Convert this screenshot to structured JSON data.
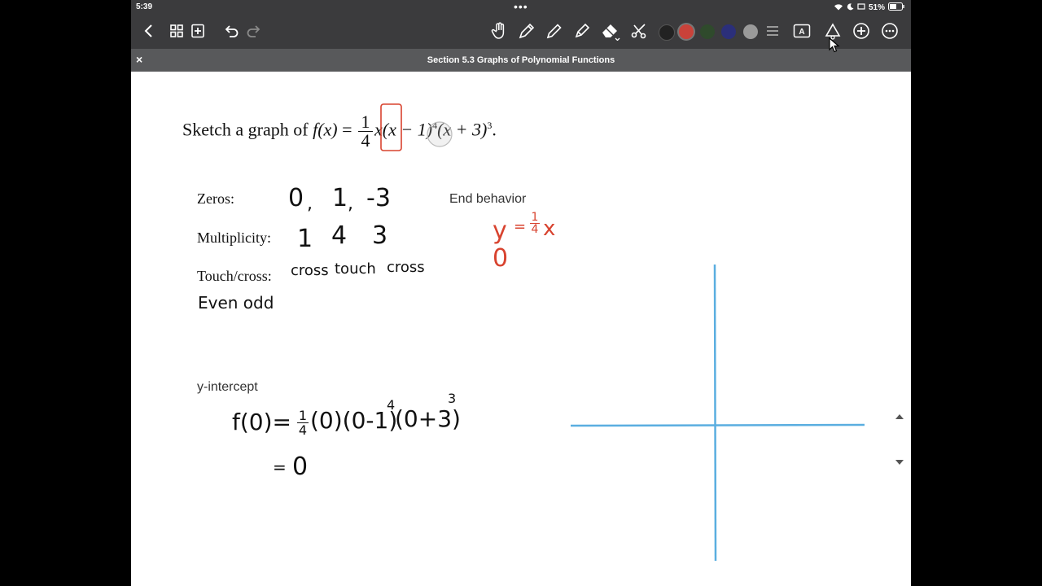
{
  "status": {
    "time": "5:39",
    "battery": "51%"
  },
  "toolbar": {
    "icons": [
      "back-icon",
      "grid-icon",
      "add-page-icon",
      "undo-icon",
      "redo-icon",
      "hand-icon",
      "pen-icon",
      "pencil-icon",
      "highlighter-icon",
      "eraser-icon",
      "scissors-icon",
      "menu-icon",
      "text-box-icon",
      "shapes-icon",
      "add-icon",
      "more-icon"
    ],
    "colors": [
      "#222222",
      "#c9423a",
      "#2f4a2c",
      "#2b2f7a",
      "#9a9a9a"
    ]
  },
  "titlebar": {
    "close_label": "×",
    "title": "Section 5.3 Graphs of Polynomial Functions"
  },
  "problem": {
    "prefix": "Sketch a graph of",
    "f": "f",
    "x_paren": "(x)",
    "eq": "=",
    "frac_num": "1",
    "frac_den": "4",
    "x1": "x",
    "factor2": "(x − 1)",
    "exp2": "4",
    "factor3": "(x + 3)",
    "exp3": "3",
    "period": "."
  },
  "labels": {
    "zeros": "Zeros:",
    "multiplicity": "Multiplicity:",
    "touch_cross": "Touch/cross:",
    "end_behavior": "End behavior",
    "y_intercept": "y-intercept"
  },
  "handwriting": {
    "zeros": [
      "0",
      "1",
      "-3"
    ],
    "multiplicities": [
      "1",
      "4",
      "3"
    ],
    "touch_cross": [
      "cross",
      "touch",
      "cross"
    ],
    "even_odd": "Even odd",
    "end_y": "y",
    "end_eq": "=",
    "end_num": "1",
    "end_den": "4",
    "end_x": "x",
    "end_zero": "0",
    "fy_start": "f(0)=",
    "fy_num": "1",
    "fy_den": "4",
    "fy_rest": "(0)(0-1)",
    "fy_exp1": "4",
    "fy_factor": "(0+3)",
    "fy_exp2": "3",
    "result_eq": "=",
    "result": "0"
  },
  "colors": {
    "red_ink": "#d8432f",
    "axis_blue": "#5aaee0",
    "toolbar_bg": "#3b3b3d",
    "titlebar_bg": "#58595b"
  }
}
